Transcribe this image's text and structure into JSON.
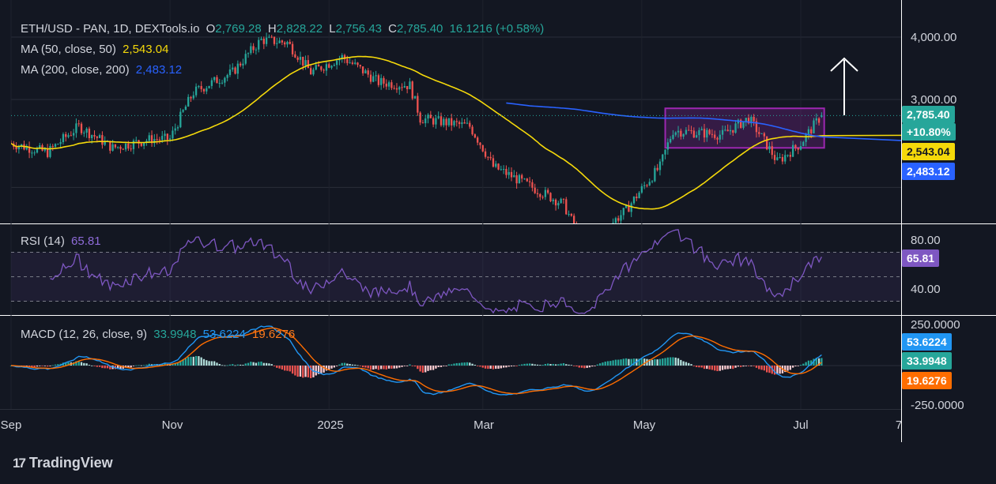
{
  "header": {
    "symbol": "ETH/USD - PAN, 1D, DEXTools.io",
    "o_label": "O",
    "o_value": "2,769.28",
    "h_label": "H",
    "h_value": "2,828.22",
    "l_label": "L",
    "l_value": "2,756.43",
    "c_label": "C",
    "c_value": "2,785.40",
    "change": "16.1216 (+0.58%)"
  },
  "ma50": {
    "label": "MA (50, close, 50)",
    "value": "2,543.04",
    "color": "#f5d90a"
  },
  "ma200": {
    "label": "MA (200, close, 200)",
    "value": "2,483.12",
    "color": "#2962ff"
  },
  "rsi": {
    "label": "RSI (14)",
    "value": "65.81",
    "color": "#7e57c2"
  },
  "macd": {
    "label": "MACD (12, 26, close, 9)",
    "histogram": "33.9948",
    "macd_line": "53.6224",
    "signal": "19.6276"
  },
  "price_tags": {
    "close": "2,785.40",
    "pct": "+10.80%",
    "ma50": "2,543.04",
    "ma200": "2,483.12",
    "rsi": "65.81",
    "macd_line": "53.6224",
    "histogram": "33.9948",
    "signal": "19.6276"
  },
  "price_axis": [
    "4,000.00",
    "3,000.00"
  ],
  "rsi_axis": [
    "80.00",
    "40.00"
  ],
  "macd_axis": [
    "250.0000",
    "-250.0000"
  ],
  "x_axis": [
    "Sep",
    "Nov",
    "2025",
    "Mar",
    "May",
    "Jul",
    "7"
  ],
  "brand": {
    "name": "TradingView"
  },
  "colors": {
    "background": "#131722",
    "bull": "#26a69a",
    "bear": "#ef5350",
    "range_box": "#9c27b0",
    "arrow": "#ffffff"
  },
  "chart_data": {
    "type": "candlestick",
    "interval": "1D",
    "y_axis": {
      "ticks": [
        3000,
        4000
      ],
      "ylim": [
        1400,
        4200
      ]
    },
    "close_series_approx": [
      {
        "date": "2024-09-01",
        "close": 2450
      },
      {
        "date": "2024-09-15",
        "close": 2350
      },
      {
        "date": "2024-09-27",
        "close": 2650
      },
      {
        "date": "2024-10-10",
        "close": 2400
      },
      {
        "date": "2024-10-25",
        "close": 2500
      },
      {
        "date": "2024-11-01",
        "close": 2500
      },
      {
        "date": "2024-11-10",
        "close": 3100
      },
      {
        "date": "2024-11-25",
        "close": 3400
      },
      {
        "date": "2024-12-06",
        "close": 3950
      },
      {
        "date": "2024-12-16",
        "close": 3900
      },
      {
        "date": "2024-12-25",
        "close": 3400
      },
      {
        "date": "2025-01-06",
        "close": 3650
      },
      {
        "date": "2025-01-20",
        "close": 3250
      },
      {
        "date": "2025-02-01",
        "close": 3200
      },
      {
        "date": "2025-02-05",
        "close": 2750
      },
      {
        "date": "2025-02-24",
        "close": 2650
      },
      {
        "date": "2025-03-05",
        "close": 2200
      },
      {
        "date": "2025-03-20",
        "close": 2000
      },
      {
        "date": "2025-04-01",
        "close": 1850
      },
      {
        "date": "2025-04-09",
        "close": 1500
      },
      {
        "date": "2025-04-25",
        "close": 1800
      },
      {
        "date": "2025-05-08",
        "close": 2200
      },
      {
        "date": "2025-05-13",
        "close": 2600
      },
      {
        "date": "2025-06-01",
        "close": 2550
      },
      {
        "date": "2025-06-11",
        "close": 2750
      },
      {
        "date": "2025-06-22",
        "close": 2250
      },
      {
        "date": "2025-07-01",
        "close": 2450
      },
      {
        "date": "2025-07-09",
        "close": 2785.4
      }
    ],
    "ma50_last": 2543.04,
    "ma200_last": 2483.12,
    "rsi_last": 65.81,
    "rsi_levels": [
      80,
      40
    ],
    "macd_last": {
      "macd": 53.6224,
      "histogram": 33.9948,
      "signal": 19.6276
    },
    "annotations": [
      "consolidation range box (May–Jul)",
      "upward arrow"
    ]
  }
}
